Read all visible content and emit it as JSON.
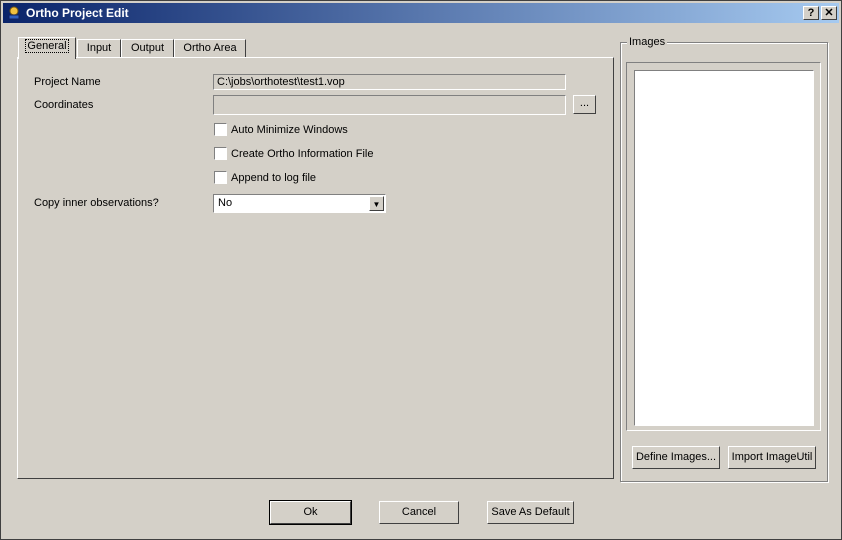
{
  "window": {
    "title": "Ortho Project Edit",
    "help_button": "?",
    "close_button": "✕"
  },
  "tabs": [
    {
      "label": "General",
      "active": true
    },
    {
      "label": "Input",
      "active": false
    },
    {
      "label": "Output",
      "active": false
    },
    {
      "label": "Ortho Area",
      "active": false
    }
  ],
  "general": {
    "project_name_label": "Project Name",
    "project_name_value": "C:\\jobs\\orthotest\\test1.vop",
    "coordinates_label": "Coordinates",
    "coordinates_value": "",
    "browse_button": "...",
    "checkboxes": [
      {
        "label": "Auto Minimize Windows",
        "checked": false
      },
      {
        "label": "Create Ortho Information File",
        "checked": false
      },
      {
        "label": "Append to log file",
        "checked": false
      }
    ],
    "copy_inner_label": "Copy inner observations?",
    "copy_inner_value": "No"
  },
  "images": {
    "group_title": "Images",
    "define_button": "Define Images...",
    "import_button": "Import ImageUtil"
  },
  "footer": {
    "ok": "Ok",
    "cancel": "Cancel",
    "save_default": "Save As Default"
  }
}
